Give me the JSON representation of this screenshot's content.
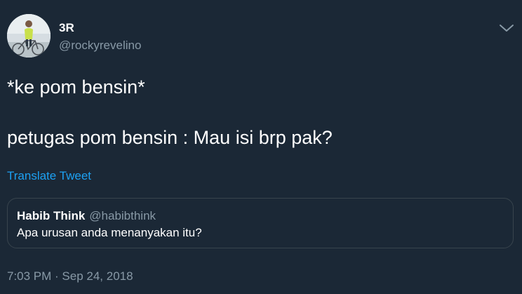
{
  "author": {
    "display_name": "3R",
    "handle": "@rockyrevelino",
    "avatar_icon": "user-avatar-with-bicycle"
  },
  "menu_icon": "chevron-down-icon",
  "tweet": {
    "line1": "*ke pom bensin*",
    "line2": "petugas pom bensin : Mau isi brp pak?"
  },
  "translate_label": "Translate Tweet",
  "quoted": {
    "display_name": "Habib Think",
    "handle": "@habibthink",
    "text": "Apa urusan anda menanyakan itu?"
  },
  "timestamp": "7:03 PM · Sep 24, 2018",
  "colors": {
    "background": "#1b2836",
    "text": "#ffffff",
    "muted": "#8899a6",
    "link": "#1da1f2",
    "border": "#38444d"
  }
}
